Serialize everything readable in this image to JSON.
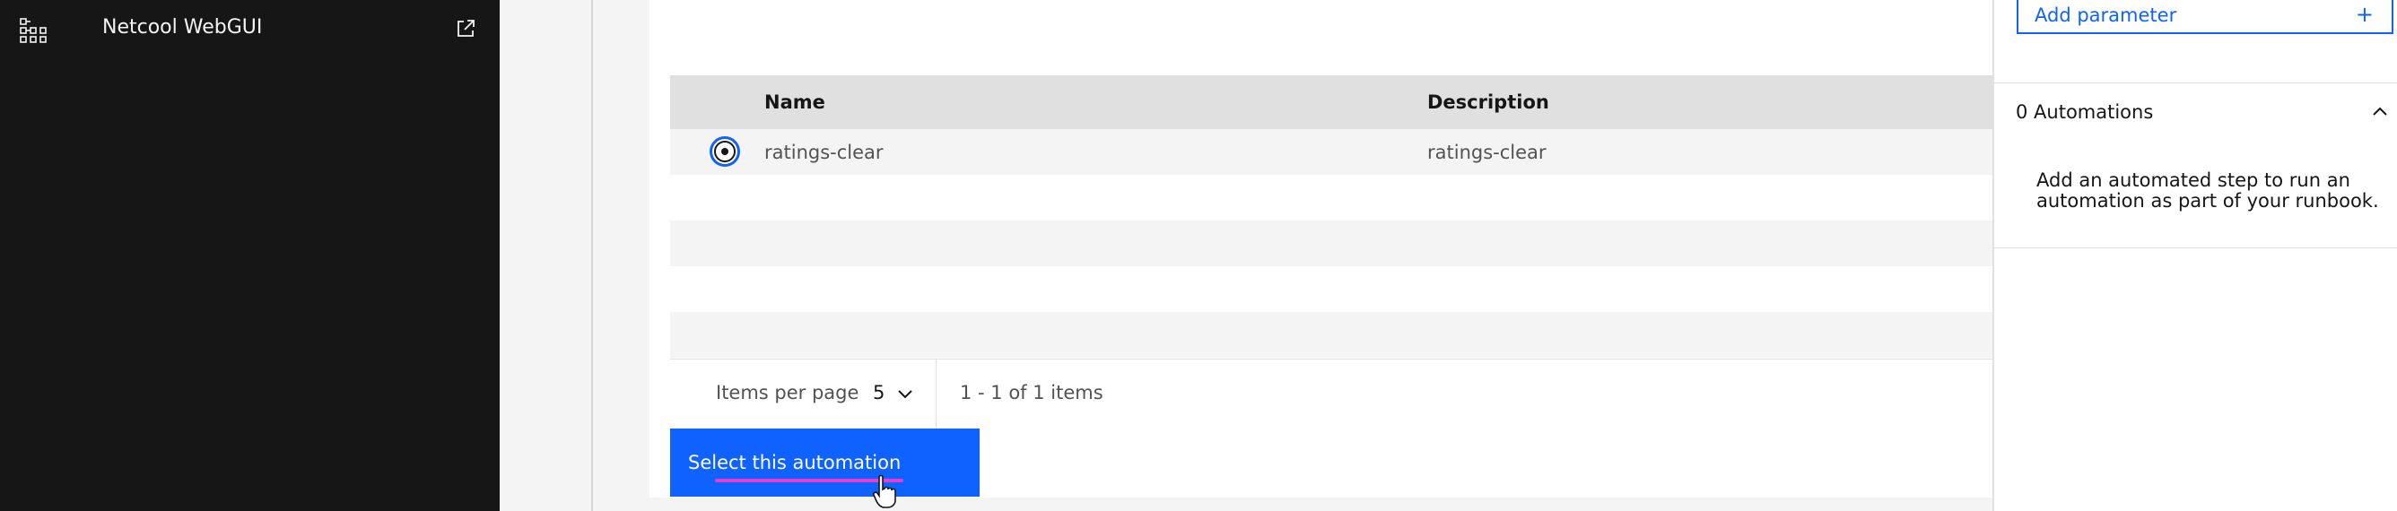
{
  "nav": {
    "app_title": "Netcool WebGUI",
    "app_icon": "app-switcher-grid-icon",
    "launch_icon": "launch-external-icon"
  },
  "table": {
    "headers": {
      "name": "Name",
      "description": "Description"
    },
    "rows": [
      {
        "name": "ratings-clear",
        "description": "ratings-clear",
        "selected": true
      }
    ]
  },
  "pagination": {
    "items_per_page_label": "Items per page",
    "items_per_page_value": "5",
    "range_text": "1 - 1 of 1 items"
  },
  "actions": {
    "select_label": "Select this automation"
  },
  "right_panel": {
    "add_parameter_label": "Add parameter",
    "add_parameter_icon": "+",
    "automations_title": "0 Automations",
    "automations_help": "Add an automated step to run an automation as part of your runbook."
  },
  "colors": {
    "primary": "#0f62fe",
    "nav_bg": "#161616",
    "highlight": "#e93cce"
  }
}
